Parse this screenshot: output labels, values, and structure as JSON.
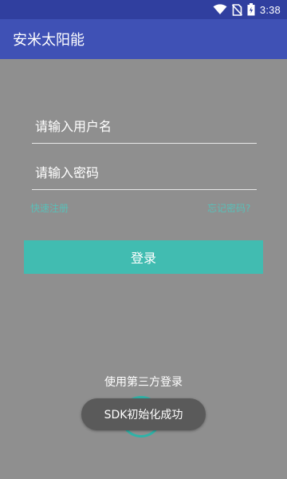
{
  "status_bar": {
    "time": "3:38",
    "icons": [
      "wifi-icon",
      "no-sim-icon",
      "battery-icon"
    ]
  },
  "app_bar": {
    "title": "安米太阳能"
  },
  "login_form": {
    "username_placeholder": "请输入用户名",
    "password_placeholder": "请输入密码",
    "register_link": "快速注册",
    "forgot_link": "忘记密码?",
    "login_button": "登录"
  },
  "third_party": {
    "label": "使用第三方登录"
  },
  "toast": {
    "message": "SDK初始化成功"
  },
  "colors": {
    "status_bar": "#303f9f",
    "app_bar": "#3f51b5",
    "accent": "#41bcb1",
    "background": "#8f8f8f"
  }
}
